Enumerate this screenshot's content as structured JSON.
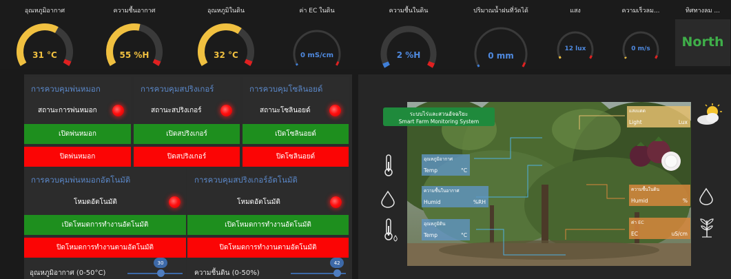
{
  "gauges": [
    {
      "title": "อุณหภูมิอากาศ",
      "value": "31 °C",
      "color": "#f0c040",
      "fraction": 0.62
    },
    {
      "title": "ความชื้นอากาศ",
      "value": "55 %H",
      "color": "#f0c040",
      "fraction": 0.55
    },
    {
      "title": "อุณหภูมิในดิน",
      "value": "32 °C",
      "color": "#f0c040",
      "fraction": 0.64
    },
    {
      "title": "ค่า EC ในดิน",
      "value": "0 mS/cm",
      "color": "#3f7fd8",
      "fraction": 0.0
    },
    {
      "title": "ความชื้นในดิน",
      "value": "2 %H",
      "color": "#3f7fd8",
      "fraction": 0.04
    },
    {
      "title": "ปริมาณน้ำฝนที่วัดได้",
      "value": "0 mm",
      "color": "#3f7fd8",
      "fraction": 0.0
    },
    {
      "title": "แสง",
      "value": "12 lux",
      "color": "#f0c040",
      "fraction": 0.03
    },
    {
      "title": "ความเร็วลม...",
      "value": "0 m/s",
      "color": "#f0c040",
      "fraction": 0.0
    }
  ],
  "wind_direction": {
    "title": "ทิศทางลม ...",
    "value": "North"
  },
  "controls": {
    "mist": {
      "title": "การควบคุมพ่นหมอก",
      "status": "สถานะการพ่นหมอก",
      "on": "เปิดพ่นหมอก",
      "off": "ปิดพ่นหมอก"
    },
    "sprinkler": {
      "title": "การควบคุมสปริงเกอร์",
      "status": "สถานะสปริงเกอร์",
      "on": "เปิดสปริงเกอร์",
      "off": "ปิดสปริงเกอร์"
    },
    "solenoid": {
      "title": "การควบคุมโซลินอยด์",
      "status": "สถานะโซลินอยด์",
      "on": "เปิดโซลินอยด์",
      "off": "ปิดโซลินอยด์"
    },
    "auto_mist": {
      "title": "การควบคุมพ่นหมอกอัตโนมัติ",
      "status": "โหมดอัตโนมัติ",
      "on": "เปิดโหมดการทำงานอัตโนมัติ",
      "off": "ปิดโหมดการทำงานตามอัตโนมัติ",
      "slider_label": "อุณหภูมิอากาศ (0-50°C)",
      "slider_value": "30",
      "slider_fraction": 0.6
    },
    "auto_sprinkler": {
      "title": "การควบคุมสปริงเกอร์อัตโนมัติ",
      "status": "โหมดอัตโนมัติ",
      "on": "เปิดโหมดการทำงานอัตโนมัติ",
      "off": "ปิดโหมดการทำงานตามอัตโนมัติ",
      "slider_label": "ความชื้นดิน (0-50%)",
      "slider_value": "42",
      "slider_fraction": 0.84
    }
  },
  "farm": {
    "banner_th": "ระบบไร่และสวนอัจฉริยะ",
    "banner_en": "Smart Farm Monitoring System",
    "tags": {
      "air_temp": {
        "title": "อุณหภูมิอากาศ",
        "label": "Temp",
        "unit": "°C"
      },
      "air_humid": {
        "title": "ความชื้นในอากาศ",
        "label": "Humid",
        "unit": "%RH"
      },
      "soil_temp": {
        "title": "อุณหภูมิดิน",
        "label": "Temp",
        "unit": "°C"
      },
      "light": {
        "title": "แสงแดด",
        "label": "Light",
        "unit": "Lux"
      },
      "soil_humid": {
        "title": "ความชื้นในดิน",
        "label": "Humid",
        "unit": "%"
      },
      "ec": {
        "title": "ค่า EC",
        "label": "EC",
        "unit": "uS/cm"
      }
    }
  },
  "colors": {
    "led_red": "#ff1010",
    "button_green": "#1e8f1e",
    "button_red": "#fb0505",
    "panel_title_blue": "#5b88c9",
    "direction_green": "#3fae49"
  }
}
